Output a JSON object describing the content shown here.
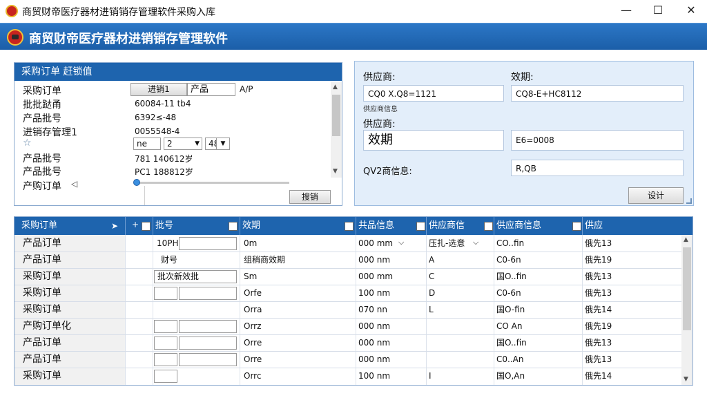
{
  "window": {
    "title": "商贸财帝医疗器材进销销存管理软件采购入库",
    "controls": {
      "minimize": "—",
      "maximize": "☐",
      "close": "✕"
    }
  },
  "app": {
    "title": "商贸财帝医疗器材进销销存管理软件"
  },
  "left_panel": {
    "title": "采购订单  赶锁值",
    "rows": [
      {
        "label": "采购订单",
        "value": ""
      },
      {
        "label": "批批跶甬",
        "value": "60084-11    tb4"
      },
      {
        "label": "产品批号",
        "value": "6392≤-48"
      },
      {
        "label": "进销存管理1",
        "value": "0055548-4"
      },
      {
        "label": "☆",
        "value": ""
      },
      {
        "label": "产品批号",
        "value": "781 140612岁"
      },
      {
        "label": "产品批号",
        "value": "PC1 188812岁"
      },
      {
        "label": "产购订单",
        "value": ""
      }
    ],
    "tab_button": "进销1",
    "tab_field": "产品",
    "tab_suffix": "A/P",
    "combo_row": {
      "a": "nе",
      "b": "2",
      "c": "48"
    },
    "back_glyph": "◁",
    "action_button": "搜销"
  },
  "right_panel": {
    "supplier_label": "供应商:",
    "supplier_value": "CQ0 X.Q8=1121",
    "validity_label": "效期:",
    "validity_value": "CQ8-E+HC8112",
    "note": "供应商信息",
    "supplier_label2": "供应商:",
    "big_field": "效期",
    "big_value": "E6=0008",
    "info_label": "QV2商信息:",
    "info_value": "R,QB",
    "submit": "设计"
  },
  "grid": {
    "columns": [
      "采购订单",
      "批号",
      "效期",
      "共品信息",
      "供应商信",
      "供应商信息",
      "供应"
    ],
    "rows": [
      {
        "a": "产品订单",
        "b": "10PH",
        "c": "0m",
        "d": "000 mm",
        "e": "压扎-选意",
        "f": "CO..fin",
        "g": "俄先13"
      },
      {
        "a": "产品订单",
        "b": "财号",
        "c": "组稍商效期",
        "d": "000 nm",
        "e": "A",
        "f": "C0-6n",
        "g": "俄先19"
      },
      {
        "a": "采购订单",
        "b": "批次新效批",
        "c": "Sm",
        "d": "000 mm",
        "e": "C",
        "f": "国O..fin",
        "g": "俄先13"
      },
      {
        "a": "采购订单",
        "b": "",
        "c": "Orfe",
        "d": "100 nm",
        "e": "D",
        "f": "C0-6n",
        "g": "俄先13"
      },
      {
        "a": "采购订单",
        "b": "",
        "c": "Orra",
        "d": "070 nn",
        "e": "L",
        "f": "国O-fin",
        "g": "俄先14"
      },
      {
        "a": "产购订单化",
        "b": "",
        "c": "Orrz",
        "d": "000 nm",
        "e": "",
        "f": "CO An",
        "g": "俄先19"
      },
      {
        "a": "产品订单",
        "b": "",
        "c": "Orre",
        "d": "000 nm",
        "e": "",
        "f": "国O..fin",
        "g": "俄先13"
      },
      {
        "a": "产品订单",
        "b": "",
        "c": "Orre",
        "d": "000 nm",
        "e": "",
        "f": "C0..An",
        "g": "俄先13"
      },
      {
        "a": "采购订单",
        "b": "",
        "c": "Orrc",
        "d": "100 nm",
        "e": "I",
        "f": "国O,An",
        "g": "俄先14"
      }
    ]
  }
}
